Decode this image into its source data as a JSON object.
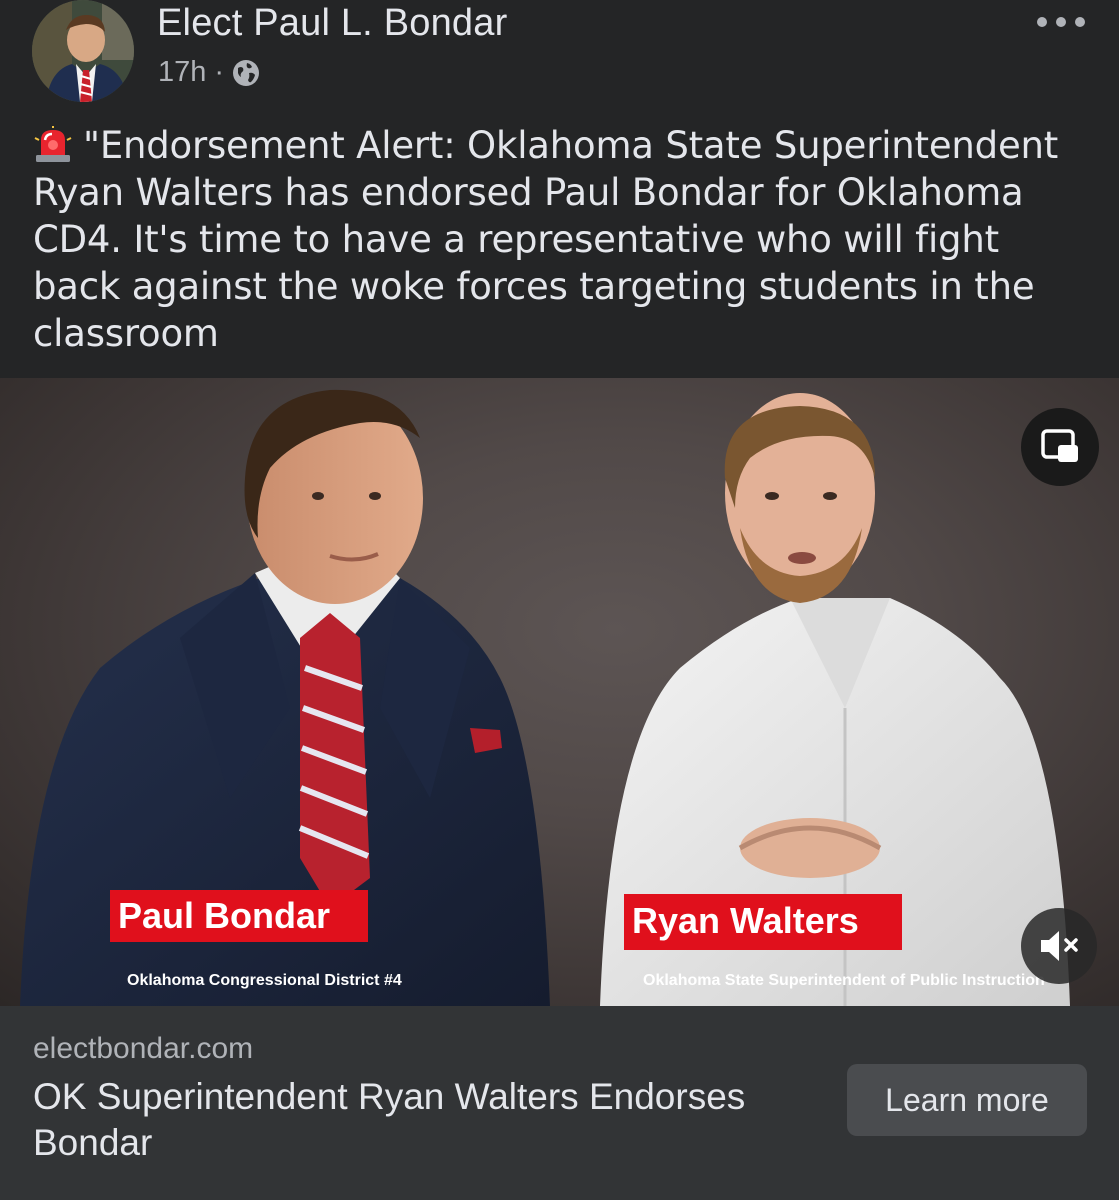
{
  "post": {
    "author": "Elect Paul L. Bondar",
    "time": "17h",
    "separator": "·",
    "text": "\"Endorsement Alert: Oklahoma State Superintendent Ryan Walters has endorsed Paul Bondar for Oklahoma CD4. It's time to have a representative who will fight back against the woke forces targeting students in the classroom",
    "emoji_icon": "rotating-light-icon",
    "privacy_icon": "globe-icon",
    "more_icon": "more-options-icon"
  },
  "video": {
    "left_name": "Paul Bondar",
    "left_subtitle": "Oklahoma Congressional District #4",
    "right_name": "Ryan Walters",
    "right_subtitle": "Oklahoma State Superintendent of Public Instruction",
    "pip_icon": "picture-in-picture-icon",
    "mute_icon": "muted-speaker-icon",
    "tag_color": "#e0101c"
  },
  "link": {
    "domain": "electbondar.com",
    "title": "OK Superintendent Ryan Walters Endorses Bondar",
    "cta": "Learn more"
  },
  "colors": {
    "background": "#242526",
    "card": "#323436",
    "button": "#4a4c4f",
    "text": "#e4e6eb",
    "muted_text": "#b0b3b8"
  }
}
